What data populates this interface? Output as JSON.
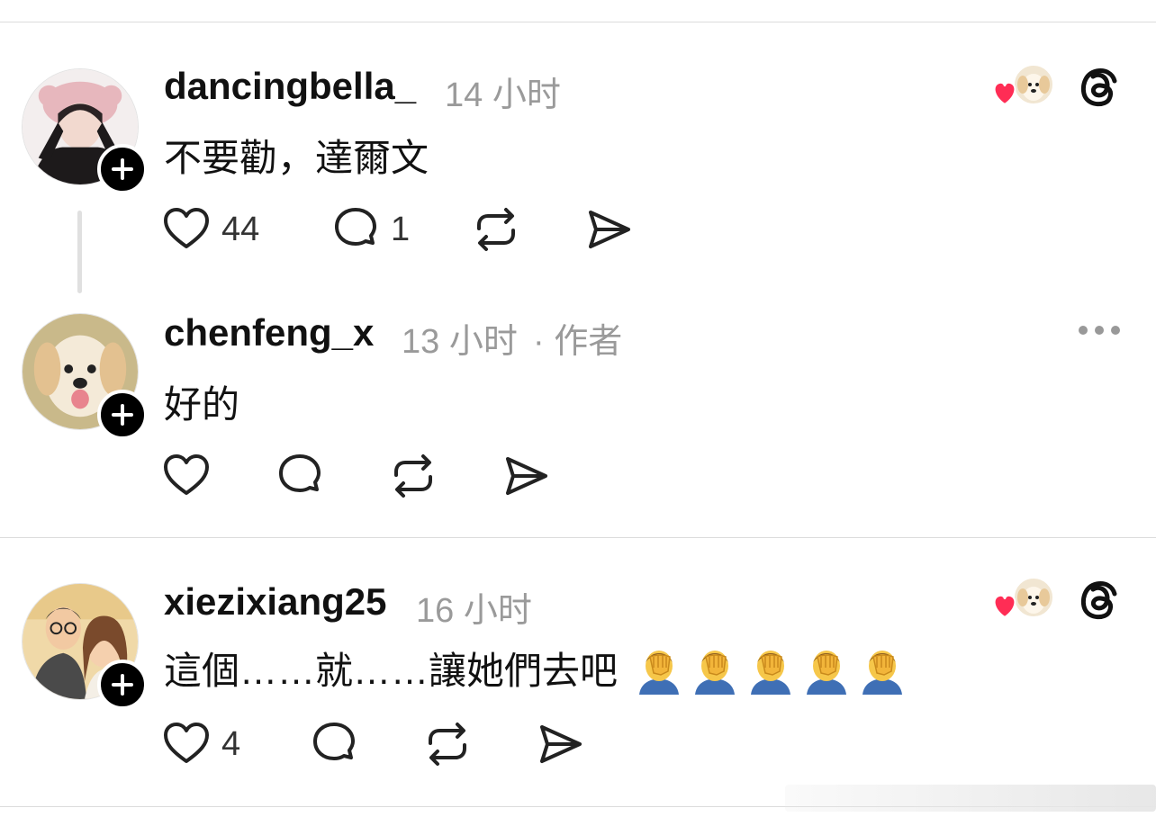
{
  "comments": [
    {
      "username": "dancingbella_",
      "time": "14 小时",
      "text": "不要勸，達爾文",
      "likes": "44",
      "replies": "1",
      "liked_by_author": true
    },
    {
      "username": "chenfeng_x",
      "time": "13 小时",
      "author_tag": "· 作者",
      "text": "好的"
    },
    {
      "username": "xiezixiang25",
      "time": "16 小时",
      "text": "這個……就……讓她們去吧",
      "emojis": [
        "facepalm",
        "facepalm",
        "facepalm",
        "facepalm",
        "facepalm"
      ],
      "likes": "4",
      "liked_by_author": true
    }
  ],
  "icons": {
    "like": "heart-icon",
    "reply": "comment-bubble-icon",
    "repost": "repost-icon",
    "share": "send-icon",
    "follow": "plus-icon",
    "threads": "threads-logo-icon",
    "more": "more-options-icon"
  },
  "colors": {
    "heart_red": "#ff2d55",
    "meta_gray": "#9a9a9a",
    "divider": "#dcdcdc"
  }
}
